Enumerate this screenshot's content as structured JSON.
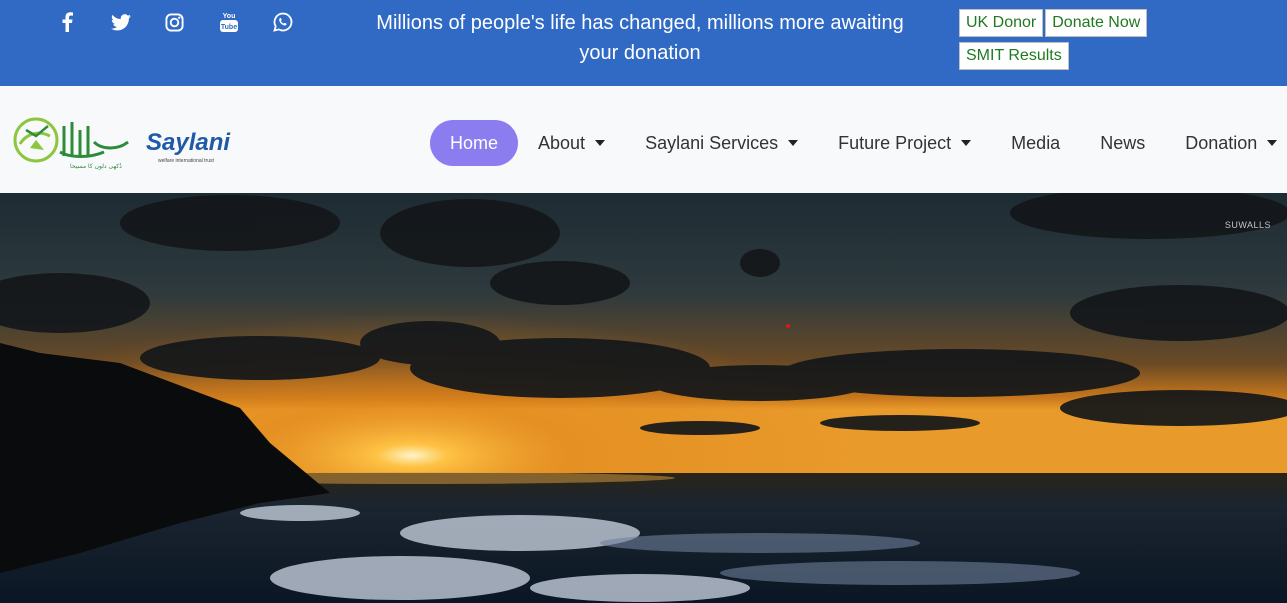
{
  "topbar": {
    "social": [
      {
        "name": "facebook-icon"
      },
      {
        "name": "twitter-icon"
      },
      {
        "name": "instagram-icon"
      },
      {
        "name": "youtube-icon"
      },
      {
        "name": "whatsapp-icon"
      }
    ],
    "tagline": "Millions of people's life has changed, millions more awaiting your donation",
    "buttons": {
      "uk_donor": "UK Donor",
      "donate_now": "Donate Now",
      "smit_results": "SMIT Results"
    },
    "colors": {
      "bar": "#316ac5",
      "button_text": "#1f7a1f"
    }
  },
  "logo": {
    "wordmark": "Saylani",
    "urdu": "سیلانی",
    "subtitle": "welfare international trust",
    "tagline_urdu": "دُکھی دلوں کا مسیحا"
  },
  "nav": {
    "items": [
      {
        "label": "Home",
        "active": true,
        "dropdown": false
      },
      {
        "label": "About",
        "active": false,
        "dropdown": true
      },
      {
        "label": "Saylani Services",
        "active": false,
        "dropdown": true
      },
      {
        "label": "Future Project",
        "active": false,
        "dropdown": true
      },
      {
        "label": "Media",
        "active": false,
        "dropdown": false
      },
      {
        "label": "News",
        "active": false,
        "dropdown": false
      },
      {
        "label": "Donation",
        "active": false,
        "dropdown": true
      }
    ],
    "active_color": "#8b7df0"
  },
  "hero": {
    "watermark": "SUWALLS"
  }
}
